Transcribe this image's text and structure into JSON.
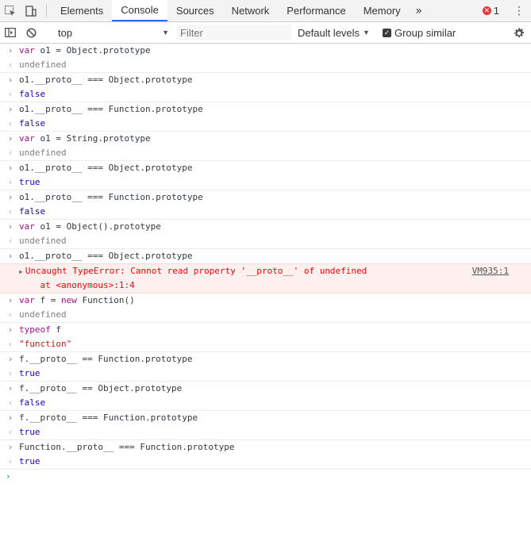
{
  "tabs": [
    "Elements",
    "Console",
    "Sources",
    "Network",
    "Performance",
    "Memory"
  ],
  "more_tabs_icon": "»",
  "error_count": "1",
  "toolbar": {
    "context": "top",
    "filter_placeholder": "Filter",
    "levels": "Default levels",
    "group_similar": "Group similar"
  },
  "console": {
    "entries": [
      {
        "input": "var o1 = Object.prototype",
        "output": "undefined"
      },
      {
        "input": "o1.__proto__ === Object.prototype",
        "output": "false"
      },
      {
        "input": "o1.__proto__ === Function.prototype",
        "output": "false"
      },
      {
        "input": "var o1 = String.prototype",
        "output": "undefined"
      },
      {
        "input": "o1.__proto__ === Object.prototype",
        "output": "true"
      },
      {
        "input": "o1.__proto__ === Function.prototype",
        "output": "false"
      },
      {
        "input": "var o1 = Object().prototype",
        "output": "undefined"
      },
      {
        "input": "o1.__proto__ === Object.prototype"
      }
    ],
    "error": {
      "message": "Uncaught TypeError: Cannot read property '__proto__' of undefined",
      "stack": "    at <anonymous>:1:4",
      "link": "VM935:1"
    },
    "entries2": [
      {
        "input": "var f = new Function()",
        "output": "undefined"
      },
      {
        "input": "typeof f",
        "output": "\"function\""
      },
      {
        "input": "f.__proto__ == Function.prototype",
        "output": "true"
      },
      {
        "input": "f.__proto__ == Object.prototype",
        "output": "false"
      },
      {
        "input": "f.__proto__ === Function.prototype",
        "output": "true"
      },
      {
        "input": "Function.__proto__ === Function.prototype",
        "output": "true"
      }
    ]
  },
  "colors": {
    "accent": "#1a73e8",
    "error": "#e23a3a"
  }
}
